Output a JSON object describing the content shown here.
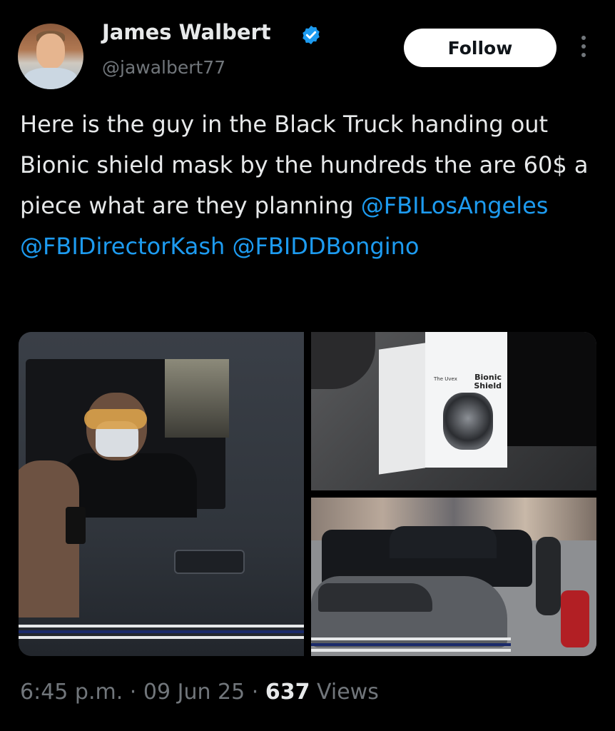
{
  "author": {
    "name": "James Walbert",
    "handle": "@jawalbert77",
    "verified_color": "#1d9bf0"
  },
  "actions": {
    "follow_label": "Follow",
    "more_icon": "more-vertical-icon"
  },
  "tweet": {
    "text_plain": "Here is the guy in the Black Truck handing out Bionic shield mask by the hundreds the are 60$ a piece what are they planning",
    "mentions": [
      "@FBILosAngeles",
      "@FBIDirectorKash",
      "@FBIDDBongino"
    ]
  },
  "media": {
    "box_label": "Bionic Shield",
    "box_brand": "The Uvex"
  },
  "meta": {
    "time": "6:45 p.m.",
    "separator": "·",
    "date": "09 Jun 25",
    "views_count": "637",
    "views_label": "Views"
  },
  "colors": {
    "background": "#000000",
    "text": "#e7e9ea",
    "secondary": "#71767b",
    "link": "#1d9bf0"
  }
}
